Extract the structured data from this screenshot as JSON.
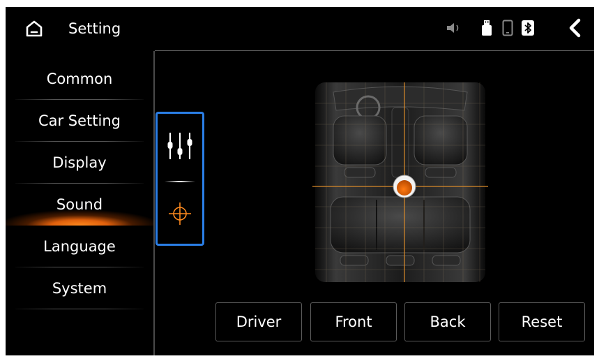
{
  "header": {
    "title": "Setting",
    "icons": [
      "home-icon",
      "volume-icon",
      "usb-icon",
      "phone-icon",
      "bluetooth-icon",
      "back-arrow-icon"
    ]
  },
  "sidebar": {
    "items": [
      {
        "label": "Common"
      },
      {
        "label": "Car Setting"
      },
      {
        "label": "Display"
      },
      {
        "label": "Sound",
        "active": true
      },
      {
        "label": "Language"
      },
      {
        "label": "System"
      }
    ]
  },
  "sound_modes": {
    "items": [
      "equalizer-icon",
      "crosshair-icon"
    ],
    "selected": "crosshair-icon"
  },
  "balance": {
    "buttons": {
      "driver": "Driver",
      "front": "Front",
      "back": "Back",
      "reset": "Reset"
    }
  },
  "colors": {
    "accent": "#ff7a12",
    "selection_border": "#2a7ee6",
    "background": "#000000",
    "text": "#ffffff"
  }
}
